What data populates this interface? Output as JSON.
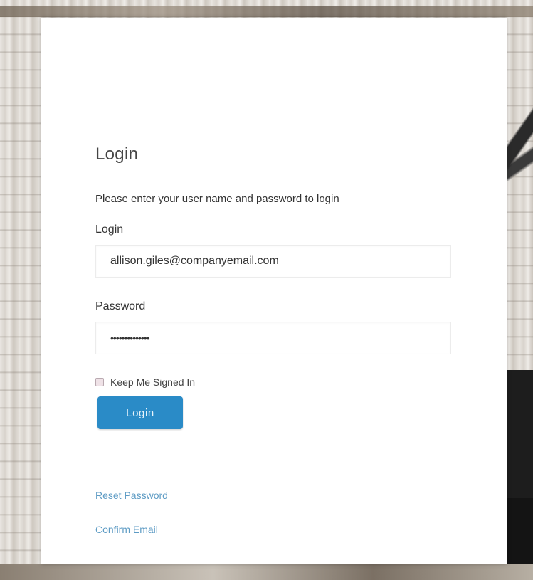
{
  "form": {
    "title": "Login",
    "instructions": "Please enter your user name and password to login",
    "login_label": "Login",
    "login_value": "allison.giles@companyemail.com",
    "password_label": "Password",
    "password_value": "••••••••••••••",
    "remember_label": "Keep Me Signed In",
    "remember_checked": false,
    "submit_label": "Login"
  },
  "links": {
    "reset_password": "Reset Password",
    "confirm_email": "Confirm Email"
  },
  "colors": {
    "button": "#2a8bc7",
    "link": "#5d9bc4",
    "card": "#ffffff"
  }
}
